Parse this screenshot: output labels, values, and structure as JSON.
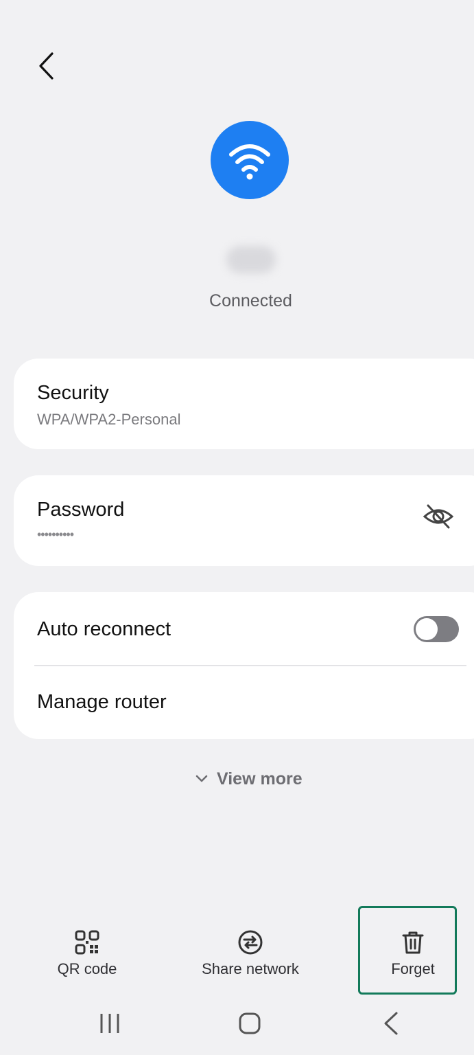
{
  "header": {
    "back_icon": "chevron-left-icon"
  },
  "network": {
    "icon": "wifi-icon",
    "icon_bg": "#1e7ff2",
    "name_blurred": true,
    "status": "Connected"
  },
  "security": {
    "title": "Security",
    "value": "WPA/WPA2-Personal"
  },
  "password": {
    "title": "Password",
    "value": "••••••••••",
    "visibility_icon": "eye-off-icon"
  },
  "options": {
    "auto_reconnect": {
      "label": "Auto reconnect",
      "enabled": false
    },
    "manage_router": {
      "label": "Manage router"
    }
  },
  "view_more": {
    "label": "View more",
    "icon": "chevron-down-icon"
  },
  "bottom_actions": [
    {
      "label": "QR code",
      "icon": "qr-code-icon"
    },
    {
      "label": "Share network",
      "icon": "share-network-icon"
    },
    {
      "label": "Forget",
      "icon": "trash-icon"
    }
  ],
  "navbar": {
    "recents": "recents-icon",
    "home": "home-icon",
    "back": "back-icon"
  },
  "colors": {
    "background": "#f1f1f3",
    "card": "#ffffff",
    "accent_highlight": "#137a5a"
  }
}
